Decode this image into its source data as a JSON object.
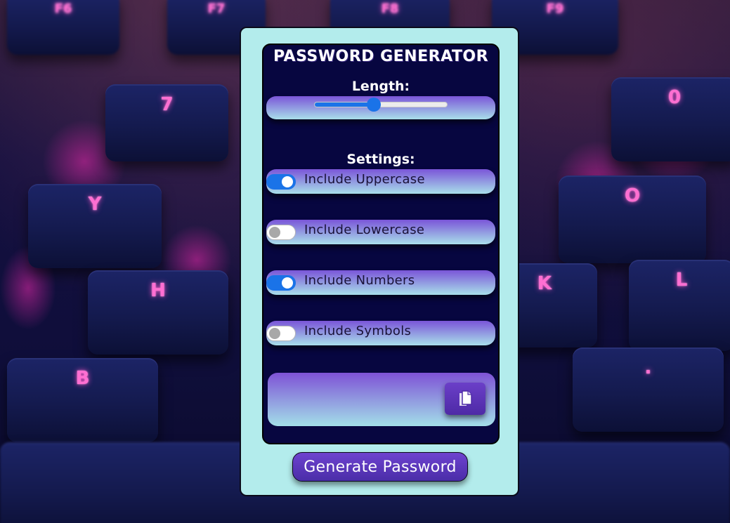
{
  "app": {
    "title": "PASSWORD GENERATOR"
  },
  "length": {
    "label": "Length:",
    "value_fraction": 0.44
  },
  "settings": {
    "label": "Settings:",
    "options": [
      {
        "label": "Include Uppercase",
        "enabled": true
      },
      {
        "label": "Include Lowercase",
        "enabled": false
      },
      {
        "label": "Include Numbers",
        "enabled": true
      },
      {
        "label": "Include Symbols",
        "enabled": false
      }
    ]
  },
  "output": {
    "password": "",
    "copy_icon": "copy-icon"
  },
  "actions": {
    "generate_label": "Generate Password"
  },
  "background_keys": [
    "F6",
    "F7",
    "F8",
    "F9",
    "7",
    "0",
    "Y",
    "O",
    "H",
    "K",
    "L",
    "B",
    "."
  ],
  "colors": {
    "card": "#b3ecec",
    "panel": "#070640",
    "accent": "#1a73e8",
    "button": "#5a36b8",
    "key_glow": "#ff6fd2"
  }
}
